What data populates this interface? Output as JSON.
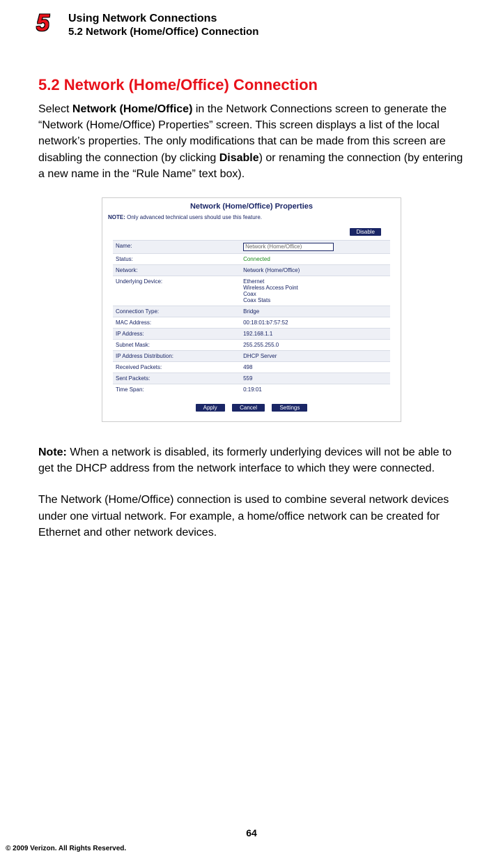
{
  "header": {
    "chapter_number": "5",
    "line1": "Using Network Connections",
    "line2": "5.2  Network (Home/Office) Connection"
  },
  "section": {
    "heading": "5.2  Network (Home/Office) Connection",
    "intro_pre": "Select ",
    "intro_bold1": "Network (Home/Office)",
    "intro_mid": " in the Network Connections screen to generate the “Network (Home/Office) Properties” screen. This screen displays a list of the local network’s properties. The only modifications that can be made from this screen are disabling the connection (by clicking ",
    "intro_bold2": "Disable",
    "intro_post": ") or renaming the connection (by entering a new name in the “Rule Name” text box)."
  },
  "screenshot": {
    "title": "Network (Home/Office) Properties",
    "note_label": "NOTE:",
    "note_text": " Only advanced technical users should use this feature.",
    "disable_label": "Disable",
    "name_field_value": "Network (Home/Office)",
    "rows": [
      {
        "k": "Name:",
        "v": ""
      },
      {
        "k": "Status:",
        "v": "Connected",
        "green": true
      },
      {
        "k": "Network:",
        "v": "Network (Home/Office)"
      },
      {
        "k": "Underlying Device:",
        "v": "Ethernet\nWireless Access Point\nCoax\nCoax Stats"
      },
      {
        "k": "Connection Type:",
        "v": "Bridge"
      },
      {
        "k": "MAC Address:",
        "v": "00:18:01:b7:57:52"
      },
      {
        "k": "IP Address:",
        "v": "192.168.1.1"
      },
      {
        "k": "Subnet Mask:",
        "v": "255.255.255.0"
      },
      {
        "k": "IP Address Distribution:",
        "v": "DHCP Server"
      },
      {
        "k": "Received Packets:",
        "v": "498"
      },
      {
        "k": "Sent Packets:",
        "v": "559"
      },
      {
        "k": "Time Span:",
        "v": "0:19:01"
      }
    ],
    "actions": {
      "apply": "Apply",
      "cancel": "Cancel",
      "settings": "Settings"
    }
  },
  "note": {
    "label": "Note:",
    "text": " When a network is disabled, its formerly underlying devices will not be able to get the DHCP address from the network interface to which they were connected."
  },
  "para2": "The Network (Home/Office) connection is used to combine several network devices under one virtual network. For example, a home/office network can be created for Ethernet and other network devices.",
  "footer": {
    "page": "64",
    "copyright": "© 2009 Verizon. All Rights Reserved."
  }
}
